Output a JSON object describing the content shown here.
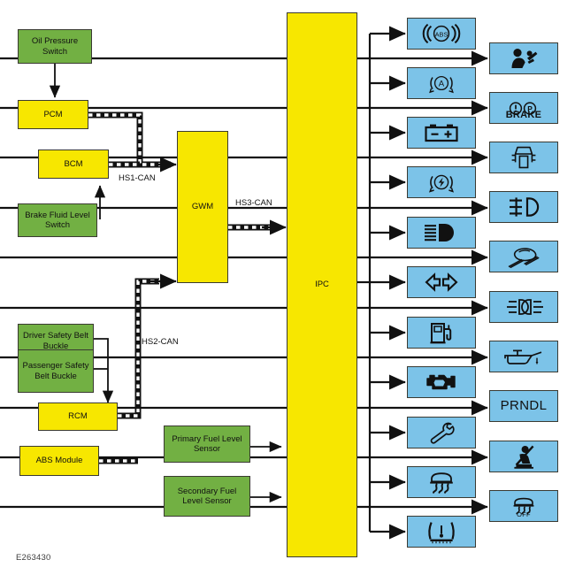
{
  "diagram": {
    "figure_code": "E263430",
    "bus_labels": [
      {
        "id": "hs1",
        "text": "HS1-CAN"
      },
      {
        "id": "hs2",
        "text": "HS2-CAN"
      },
      {
        "id": "hs3",
        "text": "HS3-CAN"
      }
    ]
  },
  "sensors": [
    {
      "id": "oil-pressure-switch",
      "label": "Oil Pressure Switch",
      "color": "#72B043"
    },
    {
      "id": "brake-fluid-level-switch",
      "label": "Brake Fluid Level Switch",
      "color": "#72B043"
    },
    {
      "id": "driver-safety-belt-buckle",
      "label": "Driver Safety Belt Buckle",
      "color": "#72B043"
    },
    {
      "id": "passenger-safety-belt-buckle",
      "label": "Passenger Safety Belt Buckle",
      "color": "#72B043"
    },
    {
      "id": "primary-fuel-level-sensor",
      "label": "Primary Fuel Level Sensor",
      "color": "#72B043"
    },
    {
      "id": "secondary-fuel-level-sensor",
      "label": "Secondary Fuel Level Sensor",
      "color": "#72B043"
    }
  ],
  "modules": [
    {
      "id": "pcm",
      "label": "PCM",
      "color": "#F7E700"
    },
    {
      "id": "bcm",
      "label": "BCM",
      "color": "#F7E700"
    },
    {
      "id": "rcm",
      "label": "RCM",
      "color": "#F7E700"
    },
    {
      "id": "abs-module",
      "label": "ABS Module",
      "color": "#F7E700"
    },
    {
      "id": "gwm",
      "label": "GWM",
      "color": "#F7E700"
    },
    {
      "id": "ipc",
      "label": "IPC",
      "color": "#F7E700"
    }
  ],
  "indicators_left": [
    {
      "id": "abs-warning",
      "icon": "abs-icon",
      "text": ""
    },
    {
      "id": "auto-hold-brake",
      "icon": "auto-hold-icon",
      "text": ""
    },
    {
      "id": "battery-charge",
      "icon": "battery-icon",
      "text": ""
    },
    {
      "id": "electric-park-brake",
      "icon": "epb-icon",
      "text": ""
    },
    {
      "id": "low-beam-headlamp",
      "icon": "low-beam-icon",
      "text": ""
    },
    {
      "id": "turn-signal",
      "icon": "turn-signal-icon",
      "text": ""
    },
    {
      "id": "low-fuel",
      "icon": "fuel-pump-icon",
      "text": ""
    },
    {
      "id": "malfunction-indicator",
      "icon": "engine-icon",
      "text": ""
    },
    {
      "id": "service-wrench",
      "icon": "wrench-icon",
      "text": ""
    },
    {
      "id": "traction-control",
      "icon": "traction-control-icon",
      "text": ""
    },
    {
      "id": "tire-pressure-monitor",
      "icon": "tpms-icon",
      "text": ""
    }
  ],
  "indicators_right": [
    {
      "id": "airbag-restraint",
      "icon": "airbag-icon",
      "text": ""
    },
    {
      "id": "park-brake",
      "icon": "brake-warning-icon",
      "text": "BRAKE"
    },
    {
      "id": "door-ajar",
      "icon": "door-ajar-icon",
      "text": ""
    },
    {
      "id": "front-fog-lamp",
      "icon": "fog-lamp-icon",
      "text": ""
    },
    {
      "id": "lane-keeping",
      "icon": "lane-keeping-icon",
      "text": ""
    },
    {
      "id": "high-beam-headlamp",
      "icon": "high-beam-icon",
      "text": ""
    },
    {
      "id": "low-oil-level",
      "icon": "oil-can-icon",
      "text": ""
    },
    {
      "id": "prndl-gear-display",
      "icon": "",
      "text": "PRNDL"
    },
    {
      "id": "safety-belt-warning",
      "icon": "seat-belt-icon",
      "text": ""
    },
    {
      "id": "traction-control-off",
      "icon": "traction-off-icon",
      "text": "OFF"
    }
  ],
  "colors": {
    "green": "#72B043",
    "yellow": "#F7E700",
    "blue": "#7CC3E8",
    "outline": "#3a3a32",
    "line": "#111111"
  }
}
